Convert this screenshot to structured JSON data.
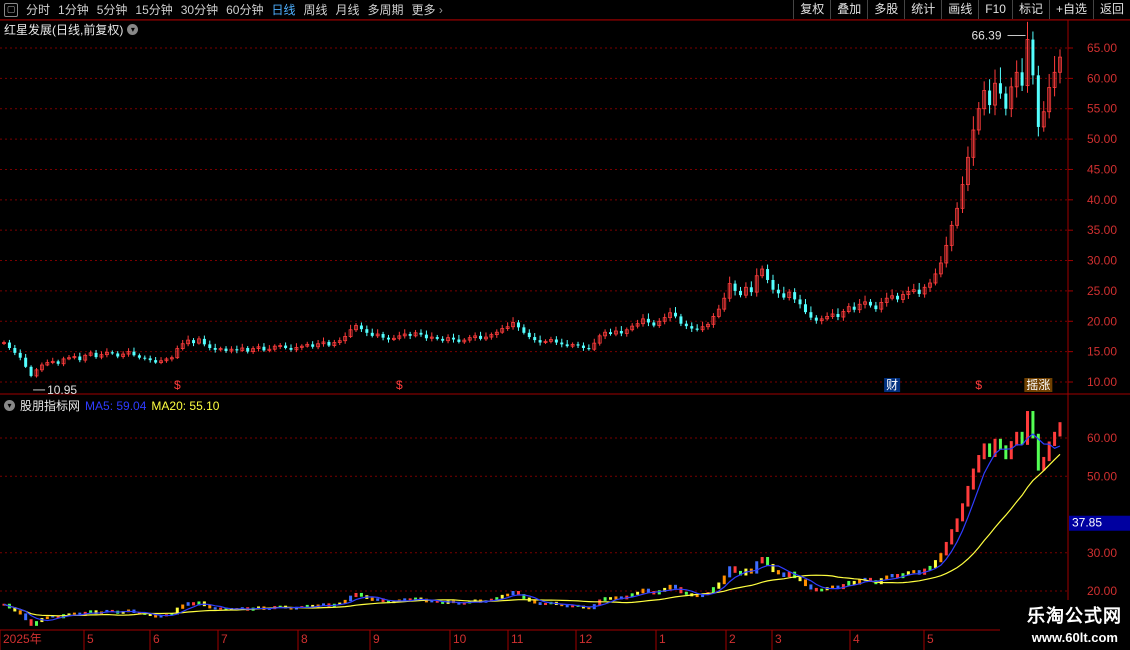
{
  "toolbar": {
    "timeframes": [
      "分时",
      "1分钟",
      "5分钟",
      "15分钟",
      "30分钟",
      "60分钟",
      "日线",
      "周线",
      "月线",
      "多周期"
    ],
    "active_index": 6,
    "more_label": "更多",
    "right_buttons": [
      "复权",
      "叠加",
      "多股",
      "统计",
      "画线",
      "F10",
      "标记",
      "+自选",
      "返回"
    ]
  },
  "main_chart": {
    "title": "红星发展(日线,前复权)",
    "high_label": "66.39",
    "low_label": "10.95",
    "y_ticks": [
      "65.00",
      "60.00",
      "55.00",
      "50.00",
      "45.00",
      "40.00",
      "35.00",
      "30.00",
      "25.00",
      "20.00",
      "15.00",
      "10.00"
    ],
    "markers": [
      "$",
      "$",
      "财",
      "$",
      "摇涨"
    ]
  },
  "indicator": {
    "name": "股朋指标网",
    "ma5_label": "MA5: 59.04",
    "ma20_label": "MA20: 55.10",
    "y_ticks": [
      "60.00",
      "50.00",
      "37.85",
      "30.00",
      "20.00"
    ],
    "current_value": "37.85"
  },
  "x_axis": {
    "labels": [
      "2025年",
      "5",
      "6",
      "7",
      "8",
      "9",
      "10",
      "11",
      "12",
      "1",
      "2",
      "3",
      "4",
      "5"
    ]
  },
  "watermark": {
    "title": "乐淘公式网",
    "url": "www.60lt.com"
  },
  "chart_data": {
    "type": "candlestick",
    "title": "红星发展(日线,前复权)",
    "ylim": [
      10,
      65
    ],
    "indicator_ylim": [
      20,
      60
    ],
    "months": [
      "2025年",
      "5",
      "6",
      "7",
      "8",
      "9",
      "10",
      "11",
      "12",
      "1",
      "2",
      "3",
      "4",
      "5"
    ],
    "closes": [
      16.5,
      15.6,
      14.8,
      14.0,
      12.5,
      11.0,
      12.0,
      12.8,
      13.2,
      13.4,
      13.0,
      13.8,
      14.0,
      14.2,
      13.6,
      14.4,
      14.8,
      14.1,
      14.5,
      14.9,
      14.7,
      14.2,
      14.6,
      15.0,
      14.4,
      14.0,
      13.9,
      13.6,
      13.2,
      13.5,
      13.8,
      14.0,
      15.5,
      16.3,
      16.9,
      16.4,
      17.1,
      16.2,
      15.6,
      15.3,
      15.5,
      15.1,
      15.4,
      15.2,
      15.6,
      15.0,
      15.5,
      15.8,
      15.2,
      15.4,
      15.9,
      16.0,
      15.6,
      15.3,
      15.7,
      15.9,
      16.2,
      15.8,
      16.3,
      16.6,
      16.0,
      16.5,
      16.8,
      17.5,
      18.6,
      19.3,
      18.7,
      18.1,
      17.6,
      17.9,
      17.3,
      17.0,
      17.2,
      17.6,
      17.9,
      17.6,
      18.1,
      17.8,
      17.2,
      17.4,
      17.1,
      16.8,
      17.3,
      17.0,
      16.6,
      16.9,
      17.3,
      17.6,
      17.1,
      17.4,
      17.8,
      18.2,
      18.8,
      19.1,
      19.8,
      19.0,
      18.1,
      17.4,
      16.9,
      16.5,
      16.7,
      17.0,
      16.5,
      16.2,
      15.9,
      16.2,
      16.0,
      15.6,
      15.4,
      16.4,
      17.6,
      18.2,
      17.9,
      18.4,
      18.0,
      18.6,
      19.2,
      19.6,
      20.4,
      19.8,
      19.3,
      20.0,
      20.6,
      21.4,
      20.8,
      19.6,
      19.2,
      18.8,
      18.6,
      19.1,
      19.5,
      20.8,
      22.0,
      23.8,
      26.2,
      25.0,
      24.3,
      25.6,
      24.8,
      27.5,
      28.6,
      26.8,
      25.2,
      24.6,
      23.9,
      24.8,
      23.6,
      22.8,
      21.5,
      20.6,
      20.1,
      20.4,
      20.8,
      21.2,
      20.7,
      21.6,
      22.4,
      21.9,
      22.8,
      23.2,
      22.6,
      22.0,
      23.1,
      23.8,
      24.2,
      23.6,
      24.4,
      24.9,
      25.2,
      24.5,
      25.6,
      26.3,
      27.8,
      29.6,
      32.5,
      35.8,
      38.6,
      42.5,
      47.0,
      51.5,
      55.0,
      58.0,
      55.6,
      59.2,
      57.5,
      55.0,
      58.6,
      61.0,
      58.8,
      66.39,
      60.5,
      52.0,
      54.5,
      58.5,
      61.0,
      63.5
    ]
  }
}
